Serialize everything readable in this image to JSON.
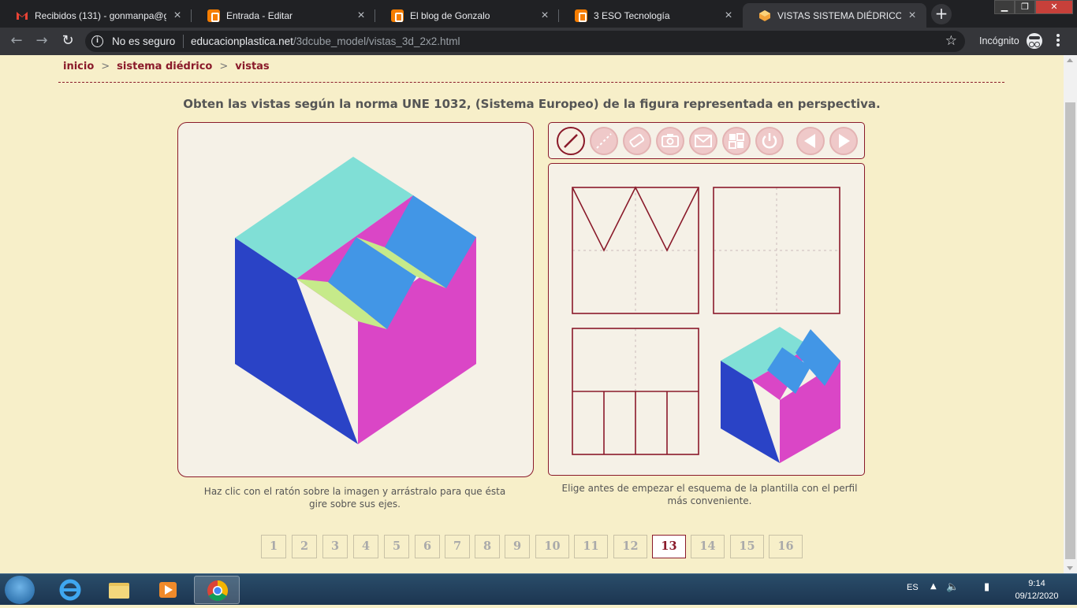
{
  "browser": {
    "tabs": [
      {
        "title": "Recibidos (131) - gonmanpa@g",
        "icon": "gmail-icon"
      },
      {
        "title": "Entrada - Editar",
        "icon": "blogger-icon"
      },
      {
        "title": "El blog de Gonzalo",
        "icon": "blogger-icon"
      },
      {
        "title": "3 ESO Tecnología",
        "icon": "blogger-icon"
      },
      {
        "title": "VISTAS SISTEMA DIÉDRICO Nivel",
        "icon": "cube-icon",
        "active": true
      }
    ],
    "security": "No es seguro",
    "url_domain": "educacionplastica.net",
    "url_path": "/3dcube_model/vistas_3d_2x2.html",
    "profile_label": "Incógnito"
  },
  "page": {
    "breadcrumb": [
      "inicio",
      "sistema diédrico",
      "vistas"
    ],
    "breadcrumb_sep": ">",
    "instruction": "Obten las vistas según la norma UNE 1032, (Sistema Europeo) de la figura representada en perspectiva.",
    "caption_left": "Haz clic con el ratón sobre la imagen y arrástralo para que ésta gire sobre sus ejes.",
    "caption_right": "Elige antes de empezar el esquema de la plantilla con el perfil más conveniente.",
    "tools": [
      "line-tool",
      "dashed-line-tool",
      "eraser-tool",
      "camera-tool",
      "mail-tool",
      "template-tool",
      "power-tool",
      "prev-arrow",
      "next-arrow"
    ],
    "colors": {
      "accent": "#8a1a2a",
      "cube_top": "#80dfd6",
      "cube_left": "#2a43c6",
      "cube_right": "#da46c6",
      "cube_step": "#4296e6",
      "cube_slope": "#c6ea8a"
    },
    "pages": [
      "1",
      "2",
      "3",
      "4",
      "5",
      "6",
      "7",
      "8",
      "9",
      "10",
      "11",
      "12",
      "13",
      "14",
      "15",
      "16"
    ],
    "current_page": "13"
  },
  "taskbar": {
    "language": "ES",
    "time": "9:14",
    "date": "09/12/2020"
  }
}
